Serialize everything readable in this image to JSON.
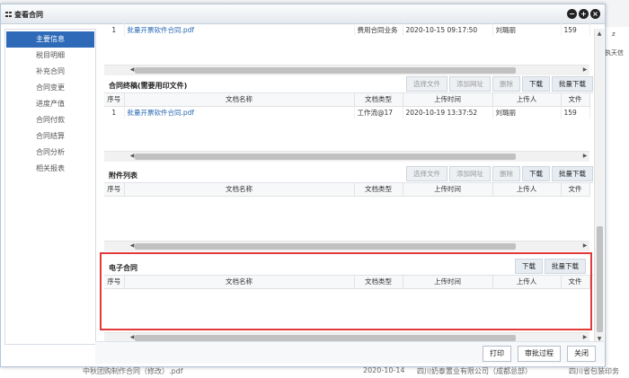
{
  "modal": {
    "title": "查看合同"
  },
  "sidebar": {
    "items": [
      {
        "label": "主要信息"
      },
      {
        "label": "税目明细"
      },
      {
        "label": "补充合同"
      },
      {
        "label": "合同变更"
      },
      {
        "label": "进度产值"
      },
      {
        "label": "合同付款"
      },
      {
        "label": "合同结算"
      },
      {
        "label": "合同分析"
      },
      {
        "label": "相关报表"
      }
    ]
  },
  "section0": {
    "row": {
      "no": "1",
      "name": "批量开票软件合同.pdf",
      "type": "费用合同业务",
      "time": "2020-10-15 09:17:50",
      "uploader": "刘璐丽",
      "extra": "159"
    }
  },
  "section1": {
    "title": "合同终稿(需要用印文件)",
    "buttons": [
      "选择文件",
      "添加网址",
      "删除",
      "下载",
      "批量下载"
    ],
    "columns": [
      "序号",
      "文档名称",
      "文档类型",
      "上传时间",
      "上传人",
      "文件"
    ],
    "row": {
      "no": "1",
      "name": "批量开票软件合同.pdf",
      "type": "工作流@17",
      "time": "2020-10-19 13:37:52",
      "uploader": "刘璐丽",
      "extra": "159"
    }
  },
  "section2": {
    "title": "附件列表",
    "buttons": [
      "选择文件",
      "添加网址",
      "删除",
      "下载",
      "批量下载"
    ],
    "columns": [
      "序号",
      "文档名称",
      "文档类型",
      "上传时间",
      "上传人",
      "文件"
    ]
  },
  "section3": {
    "title": "电子合同",
    "buttons": [
      "下载",
      "批量下载"
    ],
    "columns": [
      "序号",
      "文档名称",
      "文档类型",
      "上传时间",
      "上传人",
      "文件"
    ]
  },
  "footer": {
    "buttons": [
      "打印",
      "审批过程",
      "关闭"
    ]
  },
  "background": {
    "right_text": "执天信",
    "right_top": "z",
    "bottom_name": "中秋团购制作合同（修改）.pdf",
    "bottom_date": "2020-10-14",
    "bottom_company": "四川奶泰置业有限公司（成都总部）",
    "bottom_right": "四川省包装印务"
  }
}
